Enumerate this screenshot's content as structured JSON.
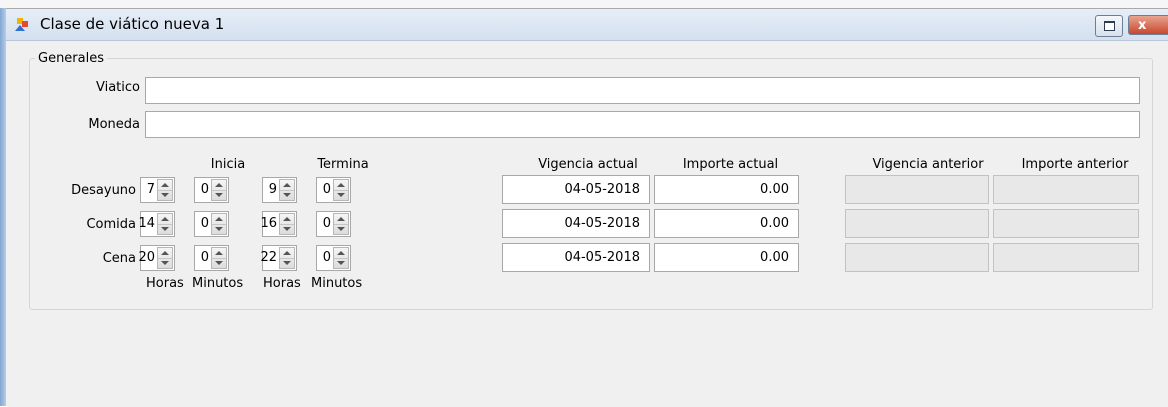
{
  "window": {
    "title": "Clase de viático nueva 1",
    "close_glyph": "x"
  },
  "group": {
    "legend": "Generales"
  },
  "fields": {
    "viatico": {
      "label": "Viatico",
      "value": ""
    },
    "moneda": {
      "label": "Moneda",
      "value": ""
    }
  },
  "headers": {
    "inicia": "Inicia",
    "termina": "Termina",
    "vigencia_actual": "Vigencia actual",
    "importe_actual": "Importe actual",
    "vigencia_anterior": "Vigencia anterior",
    "importe_anterior": "Importe anterior"
  },
  "footer": {
    "horas_1": "Horas",
    "minutos_1": "Minutos",
    "horas_2": "Horas",
    "minutos_2": "Minutos"
  },
  "rows": [
    {
      "label": "Desayuno",
      "start_h": "7",
      "start_m": "0",
      "end_h": "9",
      "end_m": "0",
      "vigencia_actual": "04-05-2018",
      "importe_actual": "0.00",
      "vigencia_anterior": "",
      "importe_anterior": ""
    },
    {
      "label": "Comida",
      "start_h": "14",
      "start_m": "0",
      "end_h": "16",
      "end_m": "0",
      "vigencia_actual": "04-05-2018",
      "importe_actual": "0.00",
      "vigencia_anterior": "",
      "importe_anterior": ""
    },
    {
      "label": "Cena",
      "start_h": "20",
      "start_m": "0",
      "end_h": "22",
      "end_m": "0",
      "vigencia_actual": "04-05-2018",
      "importe_actual": "0.00",
      "vigencia_anterior": "",
      "importe_anterior": ""
    }
  ]
}
